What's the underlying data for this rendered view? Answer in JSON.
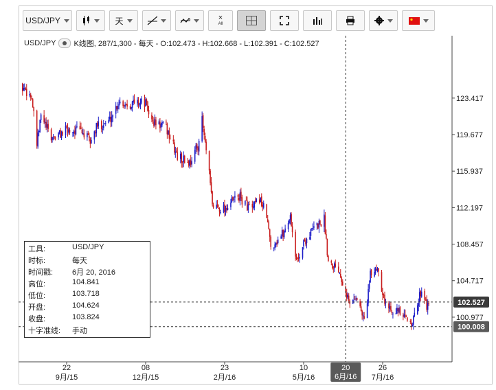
{
  "toolbar": {
    "symbol_select": "USD/JPY",
    "interval_select": "天",
    "icons": [
      "candlestick-icon",
      "calendar-day-icon",
      "draw-line-icon",
      "indicator-icon",
      "clear-all-icon",
      "crosshair-icon",
      "fullscreen-icon",
      "bar-chart-icon",
      "print-icon",
      "settings-icon",
      "flag-icon"
    ],
    "clear_all_label": "All"
  },
  "info_line": {
    "symbol": "USD/JPY",
    "details": "K线图, 287/1,300 - 每天 - O:102.473 - H:102.668 - L:102.391 - C:102.527"
  },
  "data_panel": {
    "rows": [
      {
        "key": "工具:",
        "value": "USD/JPY"
      },
      {
        "key": "时标:",
        "value": "每天"
      },
      {
        "key": "时间戳:",
        "value": "6月 20, 2016"
      },
      {
        "key": "高位:",
        "value": "104.841"
      },
      {
        "key": "低位:",
        "value": "103.718"
      },
      {
        "key": "开盘:",
        "value": "104.624"
      },
      {
        "key": "收盘:",
        "value": "103.824"
      },
      {
        "key": "十字准线:",
        "value": "手动"
      }
    ]
  },
  "colors": {
    "up": "#1c1cc8",
    "down": "#c81c1c",
    "price_tag": "#3a3a3a",
    "crosshair_tag": "#5a5a5a"
  },
  "chart_data": {
    "type": "candlestick",
    "title": "",
    "yaxis_ticks": [
      123.417,
      119.677,
      115.937,
      112.197,
      108.457,
      104.717,
      100.977
    ],
    "ylim": [
      96.4,
      128.4
    ],
    "current_price": 102.527,
    "crosshair_price": 100.008,
    "xaxis_ticks": [
      {
        "day": "22",
        "month": "9月/15",
        "date": "2015-09-22"
      },
      {
        "day": "08",
        "month": "12月/15",
        "date": "2015-12-08"
      },
      {
        "day": "23",
        "month": "2月/16",
        "date": "2016-02-23"
      },
      {
        "day": "10",
        "month": "5月/16",
        "date": "2016-05-10"
      },
      {
        "day": "26",
        "month": "7月/16",
        "date": "2016-07-26"
      }
    ],
    "crosshair_date": {
      "day": "20",
      "month": "6月/16",
      "date": "2016-06-20"
    },
    "close_path": [
      {
        "date": "2015-08-04",
        "close": 124.6
      },
      {
        "date": "2015-08-12",
        "close": 124.4
      },
      {
        "date": "2015-08-19",
        "close": 123.5
      },
      {
        "date": "2015-08-24",
        "close": 118.6
      },
      {
        "date": "2015-08-28",
        "close": 121.6
      },
      {
        "date": "2015-09-07",
        "close": 119.3
      },
      {
        "date": "2015-09-22",
        "close": 120.1
      },
      {
        "date": "2015-10-06",
        "close": 120.1
      },
      {
        "date": "2015-10-15",
        "close": 118.9
      },
      {
        "date": "2015-10-22",
        "close": 120.6
      },
      {
        "date": "2015-11-02",
        "close": 121.0
      },
      {
        "date": "2015-11-12",
        "close": 123.1
      },
      {
        "date": "2015-11-20",
        "close": 122.8
      },
      {
        "date": "2015-12-01",
        "close": 123.0
      },
      {
        "date": "2015-12-08",
        "close": 122.9
      },
      {
        "date": "2015-12-14",
        "close": 121.0
      },
      {
        "date": "2015-12-28",
        "close": 120.4
      },
      {
        "date": "2016-01-08",
        "close": 117.4
      },
      {
        "date": "2016-01-20",
        "close": 116.8
      },
      {
        "date": "2016-01-28",
        "close": 118.6
      },
      {
        "date": "2016-02-01",
        "close": 121.1
      },
      {
        "date": "2016-02-08",
        "close": 115.5
      },
      {
        "date": "2016-02-11",
        "close": 112.4
      },
      {
        "date": "2016-02-23",
        "close": 112.1
      },
      {
        "date": "2016-03-07",
        "close": 113.4
      },
      {
        "date": "2016-03-21",
        "close": 111.9
      },
      {
        "date": "2016-03-28",
        "close": 113.2
      },
      {
        "date": "2016-04-04",
        "close": 111.3
      },
      {
        "date": "2016-04-08",
        "close": 108.2
      },
      {
        "date": "2016-04-21",
        "close": 109.7
      },
      {
        "date": "2016-04-27",
        "close": 111.4
      },
      {
        "date": "2016-05-03",
        "close": 106.6
      },
      {
        "date": "2016-05-10",
        "close": 108.6
      },
      {
        "date": "2016-05-20",
        "close": 110.1
      },
      {
        "date": "2016-05-30",
        "close": 111.0
      },
      {
        "date": "2016-06-03",
        "close": 106.8
      },
      {
        "date": "2016-06-13",
        "close": 106.0
      },
      {
        "date": "2016-06-20",
        "close": 103.8
      },
      {
        "date": "2016-06-24",
        "close": 102.2
      },
      {
        "date": "2016-06-30",
        "close": 103.2
      },
      {
        "date": "2016-07-08",
        "close": 100.6
      },
      {
        "date": "2016-07-14",
        "close": 105.2
      },
      {
        "date": "2016-07-21",
        "close": 106.2
      },
      {
        "date": "2016-07-29",
        "close": 102.1
      },
      {
        "date": "2016-08-08",
        "close": 101.8
      },
      {
        "date": "2016-08-16",
        "close": 100.8
      },
      {
        "date": "2016-08-25",
        "close": 100.6
      },
      {
        "date": "2016-09-02",
        "close": 104.0
      },
      {
        "date": "2016-09-08",
        "close": 101.9
      },
      {
        "date": "2016-09-13",
        "close": 102.5
      }
    ]
  }
}
